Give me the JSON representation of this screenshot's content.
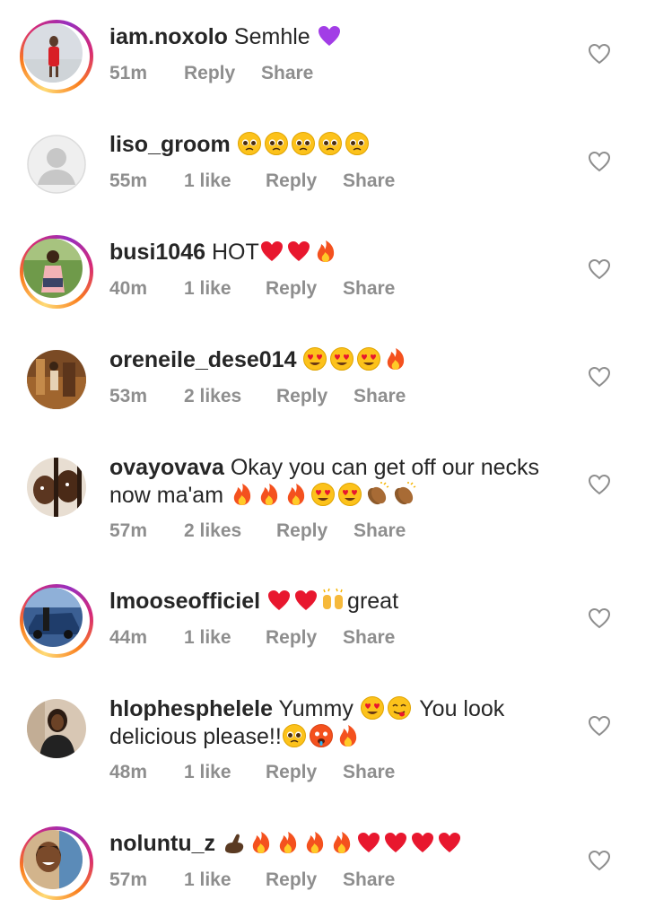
{
  "comments": [
    {
      "username": "iam.noxolo",
      "text": "Semhle",
      "time": "51m",
      "likes": "",
      "reply": "Reply",
      "share": "Share",
      "story_ring": true,
      "emoji": [
        "purple-heart"
      ]
    },
    {
      "username": "liso_groom",
      "text": "",
      "time": "55m",
      "likes": "1 like",
      "reply": "Reply",
      "share": "Share",
      "story_ring": false,
      "emoji": [
        "pleading-face",
        "pleading-face",
        "pleading-face",
        "pleading-face",
        "pleading-face"
      ]
    },
    {
      "username": "busi1046",
      "text": "HOT",
      "time": "40m",
      "likes": "1 like",
      "reply": "Reply",
      "share": "Share",
      "story_ring": true,
      "emoji": [
        "red-heart",
        "red-heart",
        "fire"
      ]
    },
    {
      "username": "oreneile_dese014",
      "text": "",
      "time": "53m",
      "likes": "2 likes",
      "reply": "Reply",
      "share": "Share",
      "story_ring": false,
      "emoji": [
        "heart-eyes",
        "heart-eyes",
        "heart-eyes",
        "fire"
      ]
    },
    {
      "username": "ovayovava",
      "text": "Okay you can get off our necks",
      "text2": "now ma'am",
      "time": "57m",
      "likes": "2 likes",
      "reply": "Reply",
      "share": "Share",
      "story_ring": false,
      "emoji": [
        "fire",
        "fire",
        "fire",
        "heart-eyes",
        "heart-eyes",
        "clapping-hands",
        "clapping-hands"
      ]
    },
    {
      "username": "lmooseofficiel",
      "text": "great",
      "time": "44m",
      "likes": "1 like",
      "reply": "Reply",
      "share": "Share",
      "story_ring": true,
      "emoji": [
        "red-heart",
        "red-heart",
        "raising-hands"
      ]
    },
    {
      "username": "hlophesphelele",
      "text": "Yummy",
      "text_after": "You look",
      "text2": "delicious please!!",
      "time": "48m",
      "likes": "1 like",
      "reply": "Reply",
      "share": "Share",
      "story_ring": false,
      "emoji": [
        "heart-eyes",
        "yum-face"
      ],
      "emoji2": [
        "pleading-face",
        "hot-face",
        "fire"
      ]
    },
    {
      "username": "noluntu_z",
      "text": "",
      "time": "57m",
      "likes": "1 like",
      "reply": "Reply",
      "share": "Share",
      "story_ring": true,
      "emoji": [
        "pointing-finger",
        "fire",
        "fire",
        "fire",
        "fire",
        "red-heart",
        "red-heart",
        "red-heart",
        "red-heart"
      ]
    }
  ],
  "colors": {
    "text": "#262626",
    "meta": "#8e8e8e",
    "heart_outline": "#8e8e8e"
  },
  "icons": {
    "like": "heart-outline-icon"
  }
}
